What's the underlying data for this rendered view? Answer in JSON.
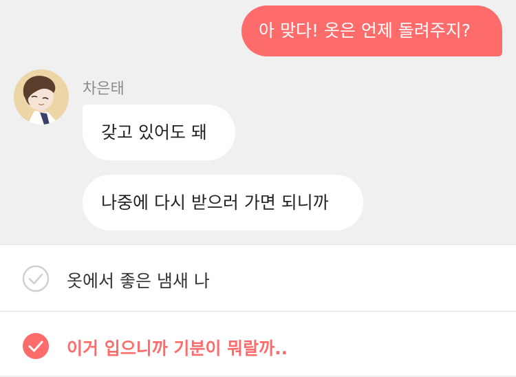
{
  "chat": {
    "outgoing_message": "아 맞다! 옷은 언제 돌려주지?",
    "sender_name": "차은태",
    "incoming_messages": [
      "갖고 있어도 돼",
      "나중에 다시 받으러 가면 되니까"
    ]
  },
  "choices": [
    {
      "label": "옷에서 좋은 냄새 나",
      "selected": false
    },
    {
      "label": "이거 입으니까 기분이 뭐랄까..",
      "selected": true
    }
  ],
  "colors": {
    "accent": "#fe6b6b",
    "chat_background": "#f0f0f0",
    "bubble_incoming": "#ffffff",
    "unchecked_icon": "#cfcfcf"
  }
}
